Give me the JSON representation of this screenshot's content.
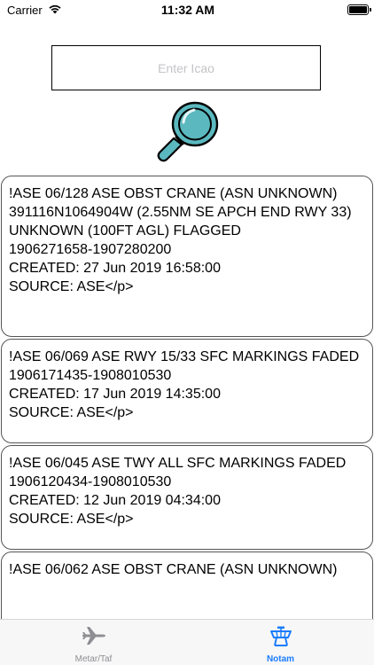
{
  "status_bar": {
    "carrier": "Carrier",
    "time": "11:32 AM"
  },
  "search": {
    "placeholder": "Enter Icao",
    "value": ""
  },
  "notams": [
    {
      "lines": [
        "!ASE 06/128 ASE OBST CRANE (ASN UNKNOWN) 391116N1064904W (2.55NM SE APCH END RWY 33)",
        "UNKNOWN (100FT AGL) FLAGGED",
        "1906271658-1907280200",
        "CREATED: 27 Jun 2019 16:58:00",
        "SOURCE: ASE</p>"
      ]
    },
    {
      "lines": [
        "!ASE 06/069 ASE RWY 15/33 SFC MARKINGS FADED 1906171435-1908010530",
        "CREATED: 17 Jun 2019 14:35:00",
        "SOURCE: ASE</p>"
      ]
    },
    {
      "lines": [
        "!ASE 06/045 ASE TWY ALL SFC MARKINGS FADED 1906120434-1908010530",
        "CREATED: 12 Jun 2019 04:34:00",
        "SOURCE: ASE</p>"
      ]
    },
    {
      "lines": [
        "!ASE 06/062 ASE OBST CRANE (ASN UNKNOWN)"
      ]
    }
  ],
  "tabs": [
    {
      "label": "Metar/Taf",
      "icon": "airplane-icon",
      "active": false
    },
    {
      "label": "Notam",
      "icon": "control-tower-icon",
      "active": true
    }
  ],
  "colors": {
    "accent": "#1a7cff",
    "inactive": "#8e8e93",
    "magnifier_glass": "#5bb8bf",
    "card_border": "#555555"
  }
}
